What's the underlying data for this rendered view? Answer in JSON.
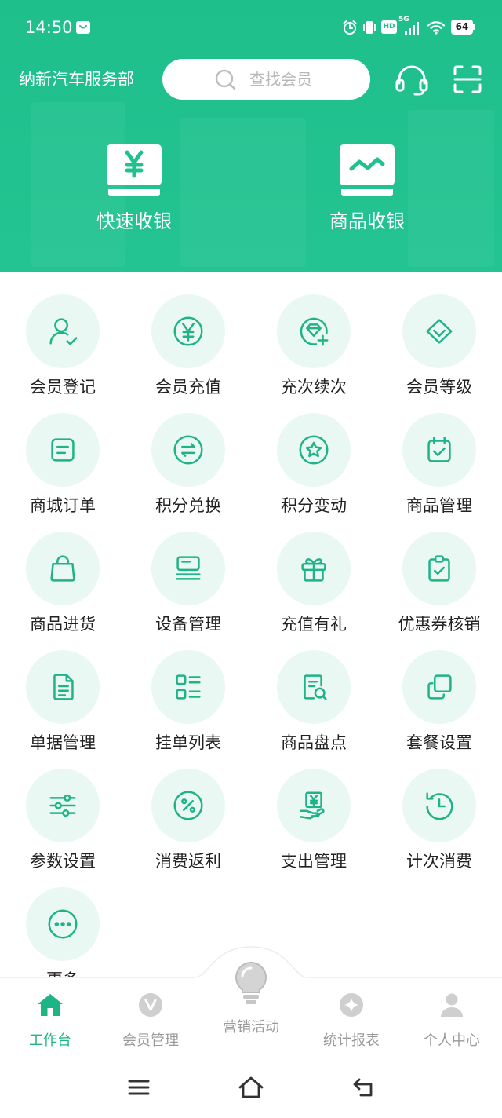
{
  "status_bar": {
    "time": "14:50",
    "hd_badge": "HD",
    "network": "5G",
    "battery": "64"
  },
  "header": {
    "store_name": "纳新汽车服务部",
    "search": {
      "placeholder": "查找会员"
    },
    "quick_actions": [
      {
        "label": "快速收银",
        "icon": "cashier-monitor-icon"
      },
      {
        "label": "商品收银",
        "icon": "product-cashier-icon"
      }
    ],
    "right_icons": [
      "headset-icon",
      "scan-icon"
    ]
  },
  "grid": [
    {
      "label": "会员登记",
      "icon": "user-check-icon"
    },
    {
      "label": "会员充值",
      "icon": "yen-circle-icon"
    },
    {
      "label": "充次续次",
      "icon": "gem-plus-icon"
    },
    {
      "label": "会员等级",
      "icon": "diamond-icon"
    },
    {
      "label": "商城订单",
      "icon": "order-icon"
    },
    {
      "label": "积分兑换",
      "icon": "exchange-icon"
    },
    {
      "label": "积分变动",
      "icon": "star-circle-icon"
    },
    {
      "label": "商品管理",
      "icon": "calendar-check-icon"
    },
    {
      "label": "商品进货",
      "icon": "shopping-bag-icon"
    },
    {
      "label": "设备管理",
      "icon": "device-icon"
    },
    {
      "label": "充值有礼",
      "icon": "gift-icon"
    },
    {
      "label": "优惠券核销",
      "icon": "clipboard-check-icon"
    },
    {
      "label": "单据管理",
      "icon": "document-icon"
    },
    {
      "label": "挂单列表",
      "icon": "list-icon"
    },
    {
      "label": "商品盘点",
      "icon": "document-search-icon"
    },
    {
      "label": "套餐设置",
      "icon": "layers-icon"
    },
    {
      "label": "参数设置",
      "icon": "sliders-icon"
    },
    {
      "label": "消费返利",
      "icon": "percent-icon"
    },
    {
      "label": "支出管理",
      "icon": "hand-yen-icon"
    },
    {
      "label": "计次消费",
      "icon": "clock-icon"
    },
    {
      "label": "更多",
      "icon": "more-icon"
    }
  ],
  "tab_bar": {
    "items": [
      {
        "label": "工作台",
        "icon": "home-icon",
        "active": true
      },
      {
        "label": "会员管理",
        "icon": "member-icon",
        "active": false
      },
      {
        "label": "营销活动",
        "icon": "lightbulb-icon",
        "active": false
      },
      {
        "label": "统计报表",
        "icon": "report-icon",
        "active": false
      },
      {
        "label": "个人中心",
        "icon": "person-icon",
        "active": false
      }
    ]
  },
  "system_nav": [
    "menu-icon",
    "home-outline-icon",
    "back-icon"
  ],
  "colors": {
    "brand": "#21c18f",
    "icon_accent": "#1fb387",
    "icon_bg": "#e9f8f2",
    "tab_active": "#1db585",
    "tab_inactive": "#9a9a9a",
    "text": "#222222"
  }
}
